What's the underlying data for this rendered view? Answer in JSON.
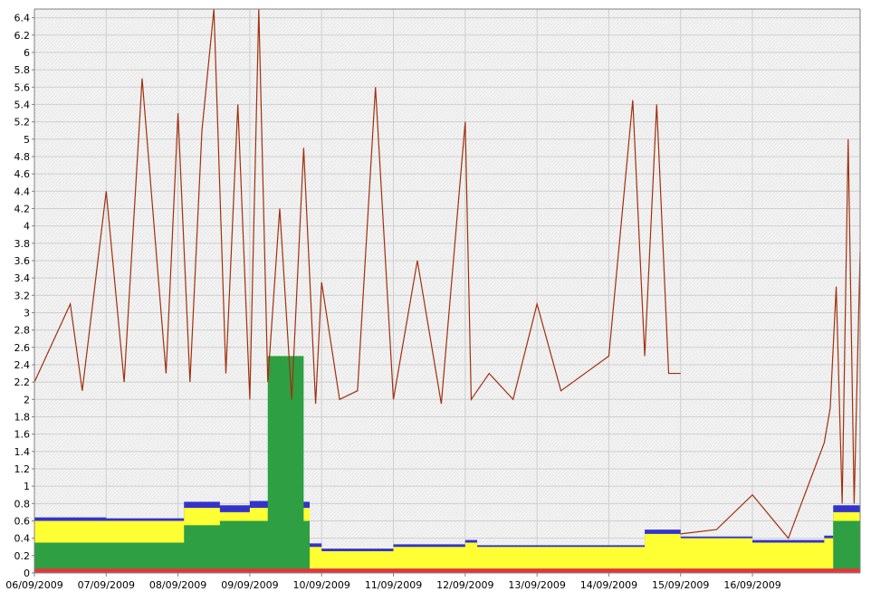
{
  "chart_data": {
    "type": "area",
    "title": "",
    "xlabel": "",
    "ylabel": "",
    "ylim": [
      0,
      6.5
    ],
    "xlim": [
      "06/09/2009",
      "17/09/2009 12:00"
    ],
    "grid": true,
    "legend": "none",
    "y_ticks": [
      0,
      0.2,
      0.4,
      0.6,
      0.8,
      1,
      1.2,
      1.4,
      1.6,
      1.8,
      2,
      2.2,
      2.4,
      2.6,
      2.8,
      3,
      3.2,
      3.4,
      3.6,
      3.8,
      4,
      4.2,
      4.4,
      4.6,
      4.8,
      5,
      5.2,
      5.4,
      5.6,
      5.8,
      6,
      6.2,
      6.4
    ],
    "y_tick_labels": [
      "0",
      "0.2",
      "0.4",
      "0.6",
      "0.8",
      "1",
      "1.2",
      "1.4",
      "1.6",
      "1.8",
      "2",
      "2.2",
      "2.4",
      "2.6",
      "2.8",
      "3",
      "3.2",
      "3.4",
      "3.6",
      "3.8",
      "4",
      "4.2",
      "4.4",
      "4.6",
      "4.8",
      "5",
      "5.2",
      "5.4",
      "5.6",
      "5.8",
      "6",
      "6.2",
      "6.4"
    ],
    "x_ticks": [
      "06/09/2009",
      "07/09/2009",
      "08/09/2009",
      "09/09/2009",
      "10/09/2009",
      "11/09/2009",
      "12/09/2009",
      "13/09/2009",
      "14/09/2009",
      "15/09/2009",
      "16/09/2009"
    ],
    "colors": {
      "red": "#e8333a",
      "green": "#2ea043",
      "yellow": "#ffff33",
      "blue": "#3333cc",
      "line": "#a0300f",
      "grid": "#cfcfcf",
      "plot_bg": "#f4f4f4"
    },
    "stack_series": [
      {
        "key": "red",
        "x": [
          "06/09/2009",
          "10/09/2009",
          "14/09/2009",
          "17/09/2009 12:00"
        ],
        "values": [
          0.05,
          0.05,
          0.05,
          0.05
        ]
      },
      {
        "key": "green",
        "x": [
          "06/09/2009",
          "07/09/2009",
          "08/09/2009 02:00",
          "08/09/2009 14:00",
          "09/09/2009",
          "09/09/2009 06:00",
          "09/09/2009 18:00",
          "09/09/2009 20:00",
          "16/09/2009",
          "17/09/2009",
          "17/09/2009 03:00",
          "17/09/2009 12:00"
        ],
        "values": [
          0.35,
          0.35,
          0.55,
          0.6,
          0.6,
          2.5,
          0.6,
          0.05,
          0.05,
          0.05,
          0.6,
          0.6
        ]
      },
      {
        "key": "yellow",
        "x": [
          "06/09/2009",
          "07/09/2009",
          "08/09/2009 02:00",
          "08/09/2009 14:00",
          "09/09/2009",
          "09/09/2009 18:00",
          "09/09/2009 20:00",
          "10/09/2009",
          "11/09/2009",
          "12/09/2009",
          "12/09/2009 04:00",
          "13/09/2009",
          "14/09/2009",
          "14/09/2009 12:00",
          "15/09/2009",
          "16/09/2009",
          "17/09/2009",
          "17/09/2009 03:00",
          "17/09/2009 12:00"
        ],
        "values": [
          0.6,
          0.6,
          0.75,
          0.7,
          0.75,
          0.75,
          0.3,
          0.25,
          0.3,
          0.35,
          0.3,
          0.3,
          0.3,
          0.45,
          0.4,
          0.35,
          0.4,
          0.7,
          0.7
        ]
      },
      {
        "key": "blue",
        "x": [
          "06/09/2009",
          "07/09/2009",
          "08/09/2009 02:00",
          "08/09/2009 14:00",
          "09/09/2009",
          "09/09/2009 18:00",
          "09/09/2009 20:00",
          "10/09/2009",
          "11/09/2009",
          "12/09/2009",
          "12/09/2009 04:00",
          "13/09/2009",
          "14/09/2009",
          "14/09/2009 12:00",
          "15/09/2009",
          "16/09/2009",
          "17/09/2009",
          "17/09/2009 03:00",
          "17/09/2009 12:00"
        ],
        "values": [
          0.64,
          0.63,
          0.82,
          0.78,
          0.83,
          0.82,
          0.34,
          0.28,
          0.33,
          0.38,
          0.32,
          0.32,
          0.32,
          0.5,
          0.42,
          0.38,
          0.43,
          0.78,
          0.78
        ]
      }
    ],
    "line_series": {
      "key": "line",
      "x": [
        "06/09/2009",
        "06/09/2009 12:00",
        "06/09/2009 16:00",
        "07/09/2009",
        "07/09/2009 06:00",
        "07/09/2009 12:00",
        "07/09/2009 20:00",
        "08/09/2009",
        "08/09/2009 04:00",
        "08/09/2009 08:00",
        "08/09/2009 12:00",
        "08/09/2009 16:00",
        "08/09/2009 20:00",
        "09/09/2009",
        "09/09/2009 03:00",
        "09/09/2009 06:00",
        "09/09/2009 10:00",
        "09/09/2009 14:00",
        "09/09/2009 18:00",
        "09/09/2009 22:00",
        "10/09/2009",
        "10/09/2009 06:00",
        "10/09/2009 12:00",
        "10/09/2009 18:00",
        "11/09/2009",
        "11/09/2009 08:00",
        "11/09/2009 16:00",
        "12/09/2009",
        "12/09/2009 02:00",
        "12/09/2009 08:00",
        "12/09/2009 16:00",
        "13/09/2009",
        "13/09/2009 08:00",
        "13/09/2009 16:00",
        "14/09/2009",
        "14/09/2009 08:00",
        "14/09/2009 12:00",
        "14/09/2009 16:00",
        "14/09/2009 20:00",
        "15/09/2009"
      ],
      "values": [
        2.2,
        3.1,
        2.1,
        4.4,
        2.2,
        5.7,
        2.3,
        5.3,
        2.2,
        5.1,
        6.5,
        2.3,
        5.4,
        2.0,
        6.5,
        2.2,
        4.2,
        2.0,
        4.9,
        1.95,
        3.35,
        2.0,
        2.1,
        5.6,
        2.0,
        3.6,
        1.95,
        5.2,
        2.0,
        2.3,
        2.0,
        3.1,
        2.1,
        2.3,
        2.5,
        5.45,
        2.5,
        5.4,
        2.3,
        2.3
      ]
    },
    "tail_line_series": {
      "key": "line",
      "x": [
        "15/09/2009",
        "15/09/2009 12:00",
        "16/09/2009",
        "16/09/2009 12:00",
        "17/09/2009",
        "17/09/2009 02:00",
        "17/09/2009 04:00",
        "17/09/2009 06:00",
        "17/09/2009 08:00",
        "17/09/2009 10:00",
        "17/09/2009 12:00"
      ],
      "values": [
        0.45,
        0.5,
        0.9,
        0.4,
        1.5,
        1.9,
        3.3,
        0.8,
        5.0,
        0.8,
        3.7
      ]
    }
  }
}
